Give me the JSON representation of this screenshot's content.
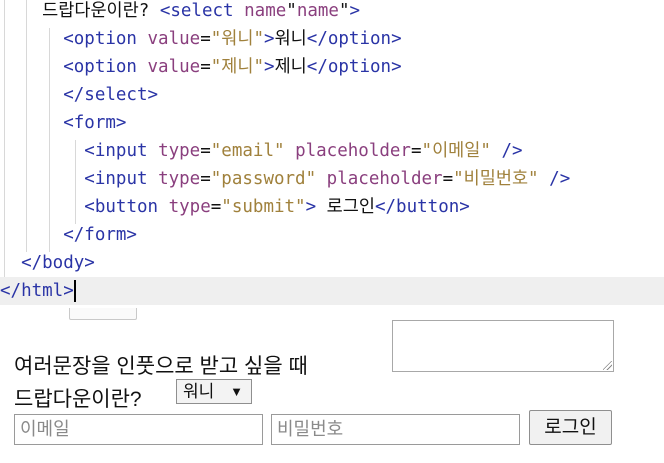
{
  "editor": {
    "lines": [
      [
        {
          "c": "txt",
          "t": "    드랍다운이란? "
        },
        {
          "c": "tag",
          "t": "<select "
        },
        {
          "c": "attr",
          "t": "name"
        },
        {
          "c": "txt",
          "t": "\""
        },
        {
          "c": "attr",
          "t": "name"
        },
        {
          "c": "txt",
          "t": "\""
        },
        {
          "c": "tag",
          "t": ">"
        }
      ],
      [
        {
          "c": "txt",
          "t": "      "
        },
        {
          "c": "tag",
          "t": "<option "
        },
        {
          "c": "attr",
          "t": "value"
        },
        {
          "c": "txt",
          "t": "="
        },
        {
          "c": "str",
          "t": "\"워니\""
        },
        {
          "c": "tag",
          "t": ">"
        },
        {
          "c": "txt",
          "t": "워니"
        },
        {
          "c": "tag",
          "t": "</option>"
        }
      ],
      [
        {
          "c": "txt",
          "t": "      "
        },
        {
          "c": "tag",
          "t": "<option "
        },
        {
          "c": "attr",
          "t": "value"
        },
        {
          "c": "txt",
          "t": "="
        },
        {
          "c": "str",
          "t": "\"제니\""
        },
        {
          "c": "tag",
          "t": ">"
        },
        {
          "c": "txt",
          "t": "제니"
        },
        {
          "c": "tag",
          "t": "</option>"
        }
      ],
      [
        {
          "c": "txt",
          "t": "      "
        },
        {
          "c": "tag",
          "t": "</select>"
        }
      ],
      [
        {
          "c": "txt",
          "t": "      "
        },
        {
          "c": "tag",
          "t": "<form>"
        }
      ],
      [
        {
          "c": "txt",
          "t": "        "
        },
        {
          "c": "tag",
          "t": "<input "
        },
        {
          "c": "attr",
          "t": "type"
        },
        {
          "c": "txt",
          "t": "="
        },
        {
          "c": "str",
          "t": "\"email\""
        },
        {
          "c": "txt",
          "t": " "
        },
        {
          "c": "attr",
          "t": "placeholder"
        },
        {
          "c": "txt",
          "t": "="
        },
        {
          "c": "str",
          "t": "\"이메일\""
        },
        {
          "c": "txt",
          "t": " "
        },
        {
          "c": "tag",
          "t": "/>"
        }
      ],
      [
        {
          "c": "txt",
          "t": "        "
        },
        {
          "c": "tag",
          "t": "<input "
        },
        {
          "c": "attr",
          "t": "type"
        },
        {
          "c": "txt",
          "t": "="
        },
        {
          "c": "str",
          "t": "\"password\""
        },
        {
          "c": "txt",
          "t": " "
        },
        {
          "c": "attr",
          "t": "placeholder"
        },
        {
          "c": "txt",
          "t": "="
        },
        {
          "c": "str",
          "t": "\"비밀번호\""
        },
        {
          "c": "txt",
          "t": " "
        },
        {
          "c": "tag",
          "t": "/>"
        }
      ],
      [
        {
          "c": "txt",
          "t": "        "
        },
        {
          "c": "tag",
          "t": "<button "
        },
        {
          "c": "attr",
          "t": "type"
        },
        {
          "c": "txt",
          "t": "="
        },
        {
          "c": "str",
          "t": "\"submit\""
        },
        {
          "c": "tag",
          "t": ">"
        },
        {
          "c": "txt",
          "t": " 로그인"
        },
        {
          "c": "tag",
          "t": "</button>"
        }
      ],
      [
        {
          "c": "txt",
          "t": "      "
        },
        {
          "c": "tag",
          "t": "</form>"
        }
      ],
      [
        {
          "c": "txt",
          "t": "  "
        },
        {
          "c": "tag",
          "t": "</body>"
        }
      ],
      [
        {
          "c": "tag",
          "t": "</html>"
        }
      ]
    ]
  },
  "preview": {
    "sentence1": "여러문장을 인풋으로 받고 싶을 때",
    "sentence2": "드랍다운이란?",
    "select_value": "워니",
    "select_arrow": "▼",
    "email_placeholder": "이메일",
    "password_placeholder": "비밀번호",
    "login_label": "로그인"
  }
}
